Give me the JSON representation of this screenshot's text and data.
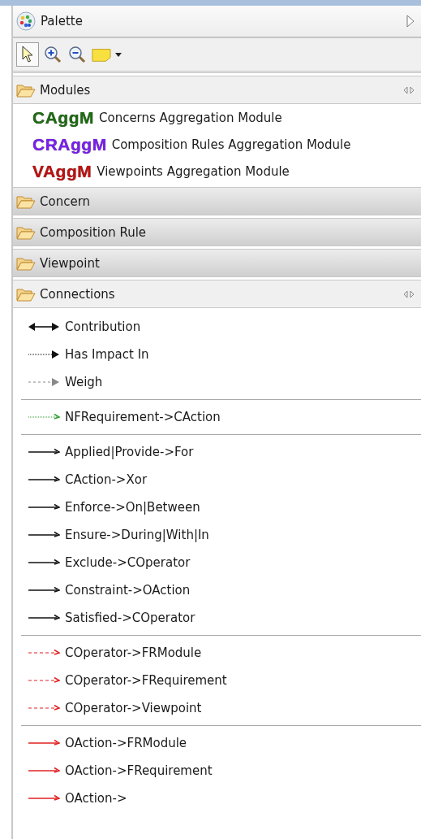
{
  "palette": {
    "title": "Palette"
  },
  "tools": [
    {
      "kind": "select",
      "selected": true
    },
    {
      "kind": "zoom-in",
      "selected": false
    },
    {
      "kind": "zoom-out",
      "selected": false
    },
    {
      "kind": "note",
      "selected": false
    }
  ],
  "drawers": [
    {
      "label": "Modules",
      "expanded": true,
      "items": [
        {
          "abbr": "CAggM",
          "color": "#1e6b12",
          "label": "Concerns Aggregation Module"
        },
        {
          "abbr": "CRAggM",
          "color": "#7a1ff0",
          "label": "Composition Rules Aggregation Module"
        },
        {
          "abbr": "VAggM",
          "color": "#c01010",
          "label": "Viewpoints Aggregation Module"
        }
      ]
    },
    {
      "label": "Concern",
      "expanded": false
    },
    {
      "label": "Composition Rule",
      "expanded": false
    },
    {
      "label": "Viewpoint",
      "expanded": false
    },
    {
      "label": "Connections",
      "expanded": true,
      "groups": [
        [
          {
            "kind": "bidirectional",
            "label": "Contribution"
          },
          {
            "kind": "dotted",
            "label": "Has Impact In"
          },
          {
            "kind": "dashed-gray",
            "label": "Weigh"
          }
        ],
        [
          {
            "kind": "dotted-green",
            "label": "NFRequirement->CAction"
          }
        ],
        [
          {
            "kind": "solid",
            "label": "Applied|Provide->For"
          },
          {
            "kind": "solid",
            "label": "CAction->Xor"
          },
          {
            "kind": "solid",
            "label": "Enforce->On|Between"
          },
          {
            "kind": "solid",
            "label": "Ensure->During|With|In"
          },
          {
            "kind": "solid",
            "label": "Exclude->COperator"
          },
          {
            "kind": "solid",
            "label": "Constraint->OAction"
          },
          {
            "kind": "solid",
            "label": "Satisfied->COperator"
          }
        ],
        [
          {
            "kind": "dashed-red",
            "label": "COperator->FRModule"
          },
          {
            "kind": "dashed-red",
            "label": "COperator->FRequirement"
          },
          {
            "kind": "dashed-red",
            "label": "COperator->Viewpoint"
          }
        ],
        [
          {
            "kind": "solid-red",
            "label": "OAction->FRModule"
          },
          {
            "kind": "solid-red",
            "label": "OAction->FRequirement"
          },
          {
            "kind": "solid-red",
            "label": "OAction->"
          }
        ]
      ]
    }
  ]
}
